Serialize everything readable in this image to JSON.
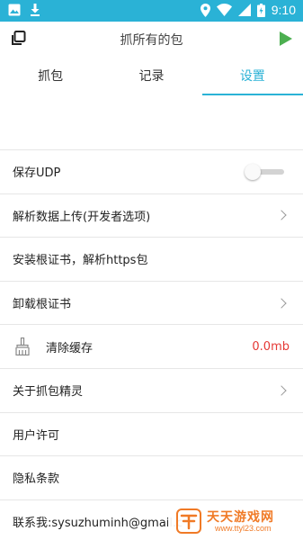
{
  "status_bar": {
    "left_icons": [
      "image-icon",
      "download-icon"
    ],
    "right_icons": [
      "location-icon",
      "wifi-icon",
      "signal-icon",
      "battery-icon"
    ],
    "time": "9:10",
    "background": "#2ab2d6"
  },
  "app_bar": {
    "title": "抓所有的包",
    "left_icon": "copy-icon",
    "right_icon": "play-icon",
    "play_color": "#4caf50"
  },
  "tabs": [
    {
      "label": "抓包",
      "active": false
    },
    {
      "label": "记录",
      "active": false
    },
    {
      "label": "设置",
      "active": true
    }
  ],
  "accent_color": "#2ab2d6",
  "settings": {
    "save_udp": {
      "label": "保存UDP",
      "enabled": false
    },
    "parse_upload": {
      "label": "解析数据上传(开发者选项)"
    },
    "install_cert": {
      "label": "安装根证书，解析https包"
    },
    "uninstall_cert": {
      "label": "卸载根证书"
    },
    "clear_cache": {
      "label": "清除缓存",
      "value": "0.0mb",
      "icon": "broom-icon"
    },
    "about": {
      "label": "关于抓包精灵"
    },
    "license": {
      "label": "用户许可"
    },
    "privacy": {
      "label": "隐私条款"
    },
    "contact": {
      "label": "联系我:sysuzhuminh@gmail.c"
    }
  },
  "watermark": {
    "title": "天天游戏网",
    "url": "www.ttyl23.com"
  }
}
